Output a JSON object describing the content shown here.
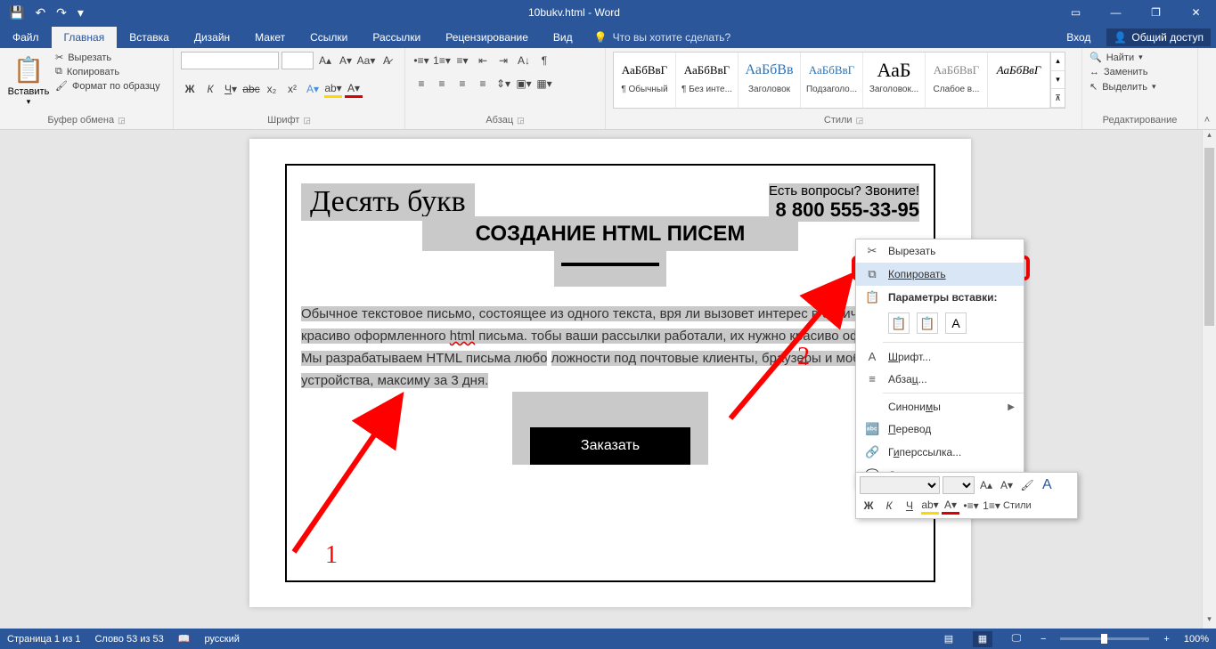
{
  "title": "10bukv.html - Word",
  "qat": {
    "save": "💾",
    "undo": "↶",
    "redo": "↷"
  },
  "winctrl": {
    "ribbon_disp": "▭",
    "min": "—",
    "restore": "❐",
    "close": "✕"
  },
  "tabs": {
    "file": "Файл",
    "home": "Главная",
    "insert": "Вставка",
    "design": "Дизайн",
    "layout": "Макет",
    "references": "Ссылки",
    "mailings": "Рассылки",
    "review": "Рецензирование",
    "view": "Вид"
  },
  "tellme_placeholder": "Что вы хотите сделать?",
  "signin": "Вход",
  "share": "Общий доступ",
  "ribbon": {
    "clipboard": {
      "paste": "Вставить",
      "cut": "Вырезать",
      "copy": "Копировать",
      "format_painter": "Формат по образцу",
      "label": "Буфер обмена"
    },
    "font": {
      "name": "",
      "size": "",
      "label": "Шрифт"
    },
    "paragraph": {
      "label": "Абзац"
    },
    "styles": {
      "items": [
        {
          "preview": "АаБбВвГ",
          "name": "¶ Обычный"
        },
        {
          "preview": "АаБбВвГ",
          "name": "¶ Без инте..."
        },
        {
          "preview": "АаБбВв",
          "name": "Заголовок"
        },
        {
          "preview": "АаБбВвГ",
          "name": "Подзаголо..."
        },
        {
          "preview": "АаБ",
          "name": "Заголовок..."
        },
        {
          "preview": "АаБбВвГ",
          "name": "Слабое в..."
        },
        {
          "preview": "АаБбВвГ",
          "name": ""
        }
      ],
      "label": "Стили"
    },
    "editing": {
      "find": "Найти",
      "replace": "Заменить",
      "select": "Выделить",
      "label": "Редактирование"
    }
  },
  "document": {
    "brand": "Десять букв",
    "contact_q": "Есть вопросы? Звоните!",
    "phone": "8 800 555-33-95",
    "heading": "СОЗДАНИЕ HTML ПИСЕМ",
    "body_pre": "Обычное текстовое письмо, состоящее из одного текста, вря",
    "body_mid1": " ли вызовет интерес в отличие от красиво оформленного ",
    "body_html": "html",
    "body_mid2": " письма. ",
    "body_mid3": "тобы ваши рассылки работали, их нужно красиво оформлять! Мы разрабатываем HTML письма любо",
    "body_post": "ложности под почтовые клиенты, браузеры и мобильные устройства, максиму",
    "body_tail": " за 3 дня.",
    "cta": "Заказать"
  },
  "context_menu": {
    "cut": "Вырезать",
    "copy": "Копировать",
    "paste_opts": "Параметры вставки:",
    "font": "Шрифт...",
    "paragraph": "Абзац...",
    "synonyms": "Синонимы",
    "translate": "Перевод",
    "hyperlink": "Гиперссылка...",
    "new_comment": "Создать примечание"
  },
  "mini_toolbar": {
    "styles": "Стили"
  },
  "annotations": {
    "one": "1",
    "two": "2"
  },
  "status": {
    "page": "Страница 1 из 1",
    "words": "Слово 53 из 53",
    "lang": "русский",
    "zoom": "100%"
  }
}
